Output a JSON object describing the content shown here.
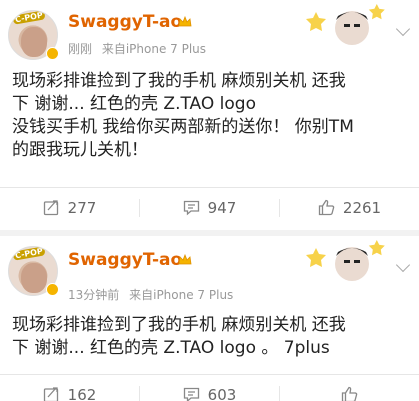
{
  "posts": [
    {
      "user": "SwaggyT-ao",
      "avatar_tag": "C-POP",
      "time": "刚刚",
      "source": "来自iPhone 7 Plus",
      "lines": [
        "现场彩排谁捡到了我的手机 麻烦别关机 还我",
        "下 谢谢... 红色的壳 Z.TAO logo",
        "没钱买手机 我给你买两部新的送你！ 你别TM",
        "的跟我玩儿关机！"
      ],
      "reposts": "277",
      "comments": "947",
      "likes": "2261"
    },
    {
      "user": "SwaggyT-ao",
      "avatar_tag": "C-POP",
      "time": "13分钟前",
      "source": "来自iPhone 7 Plus",
      "lines": [
        "现场彩排谁捡到了我的手机 麻烦别关机 还我",
        "下 谢谢... 红色的壳 Z.TAO logo 。 7plus"
      ],
      "reposts": "162",
      "comments": "603"
    }
  ],
  "icons": {
    "repost": "repost-icon",
    "comment": "comment-icon",
    "like": "like-icon",
    "verified": "verified-badge-icon",
    "crown": "crown-icon",
    "menu": "chevron-down-icon"
  },
  "colors": {
    "username": "#e06400",
    "meta": "#999999",
    "verified": "#f5b400",
    "text": "#222222"
  }
}
